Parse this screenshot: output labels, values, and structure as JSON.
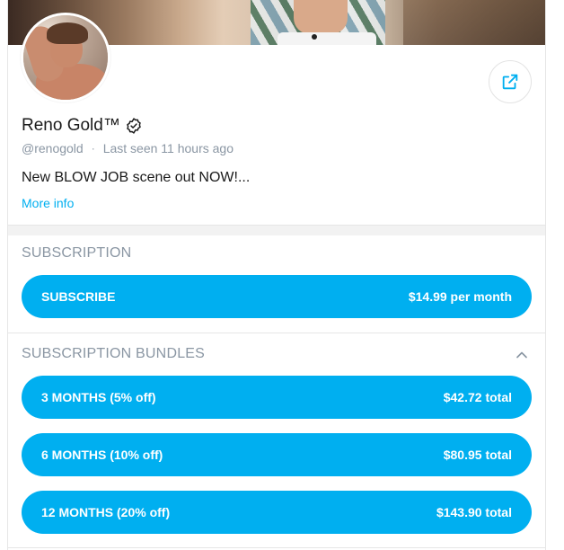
{
  "profile": {
    "name": "Reno Gold™",
    "handle": "@renogold",
    "separator": "·",
    "last_seen": "Last seen 11 hours ago",
    "bio": "New BLOW JOB scene out NOW!...",
    "more_info": "More info"
  },
  "subscription": {
    "title": "SUBSCRIPTION",
    "subscribe_label": "SUBSCRIBE",
    "price": "$14.99 per month"
  },
  "bundles": {
    "title": "SUBSCRIPTION BUNDLES",
    "items": [
      {
        "label": "3 MONTHS (5% off)",
        "price": "$42.72 total"
      },
      {
        "label": "6 MONTHS (10% off)",
        "price": "$80.95 total"
      },
      {
        "label": "12 MONTHS (20% off)",
        "price": "$143.90 total"
      }
    ]
  },
  "icons": {
    "share": "share-icon",
    "verified": "verified-badge-icon",
    "collapse": "chevron-up-icon"
  },
  "colors": {
    "accent": "#00aff0",
    "muted": "#8a96a3"
  }
}
